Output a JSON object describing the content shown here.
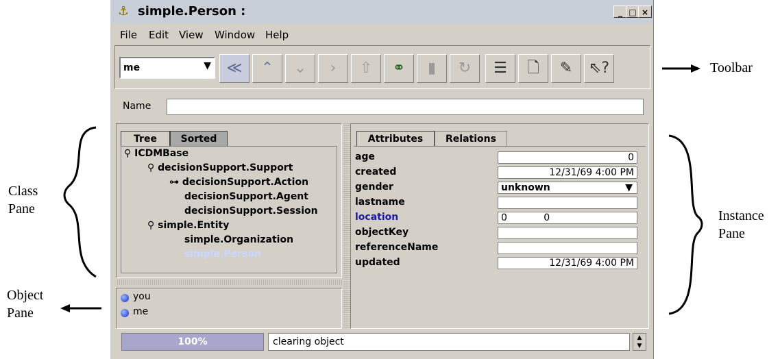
{
  "window": {
    "title": "simple.Person :",
    "min": "_",
    "max": "□",
    "close": "×"
  },
  "menu": [
    "File",
    "Edit",
    "View",
    "Window",
    "Help"
  ],
  "toolbar": {
    "combo_value": "me",
    "buttons": [
      "back-icon",
      "up-icon",
      "down-icon",
      "forward-icon",
      "upload-icon",
      "find-icon",
      "trash-icon",
      "undo-icon",
      "list-icon",
      "new-icon",
      "edit-icon",
      "help-pointer-icon"
    ]
  },
  "name_field": {
    "label": "Name",
    "value": ""
  },
  "class_pane": {
    "tabs": [
      "Tree",
      "Sorted"
    ],
    "tree": [
      {
        "label": "ICDMBase",
        "level": 0,
        "expander": "⚲"
      },
      {
        "label": "decisionSupport.Support",
        "level": 1,
        "expander": "⚲"
      },
      {
        "label": "decisionSupport.Action",
        "level": 2,
        "expander": "⊶"
      },
      {
        "label": "decisionSupport.Agent",
        "level": 2,
        "expander": ""
      },
      {
        "label": "decisionSupport.Session",
        "level": 2,
        "expander": ""
      },
      {
        "label": "simple.Entity",
        "level": 1,
        "expander": "⚲"
      },
      {
        "label": "simple.Organization",
        "level": 2,
        "expander": ""
      },
      {
        "label": "simple.Person",
        "level": 2,
        "expander": "",
        "selected": true
      }
    ]
  },
  "object_pane": {
    "objects": [
      "you",
      "me"
    ]
  },
  "instance_pane": {
    "tabs": [
      "Attributes",
      "Relations"
    ],
    "attributes": [
      {
        "name": "age",
        "value": "0",
        "align": "right"
      },
      {
        "name": "created",
        "value": "12/31/69 4:00 PM",
        "align": "right"
      },
      {
        "name": "gender",
        "value": "unknown",
        "align": "left",
        "dropdown": true
      },
      {
        "name": "lastname",
        "value": "",
        "align": "left"
      },
      {
        "name": "location",
        "value": "0            0",
        "align": "left",
        "link": true
      },
      {
        "name": "objectKey",
        "value": "",
        "align": "left"
      },
      {
        "name": "referenceName",
        "value": "",
        "align": "left"
      },
      {
        "name": "updated",
        "value": "12/31/69 4:00 PM",
        "align": "right"
      }
    ]
  },
  "status": {
    "progress": "100%",
    "message": "clearing object"
  },
  "annotations": {
    "toolbar": "Toolbar",
    "class_pane_1": "Class",
    "class_pane_2": "Pane",
    "object_pane_1": "Object",
    "object_pane_2": "Pane",
    "instance_pane_1": "Instance",
    "instance_pane_2": "Pane"
  },
  "colors": {
    "window_bg": "#d4d0c8",
    "titlebar": "#c9cfd9",
    "selection_text": "#c8d8ff",
    "link": "#1a1aa6",
    "progress": "#a8a6cc"
  }
}
